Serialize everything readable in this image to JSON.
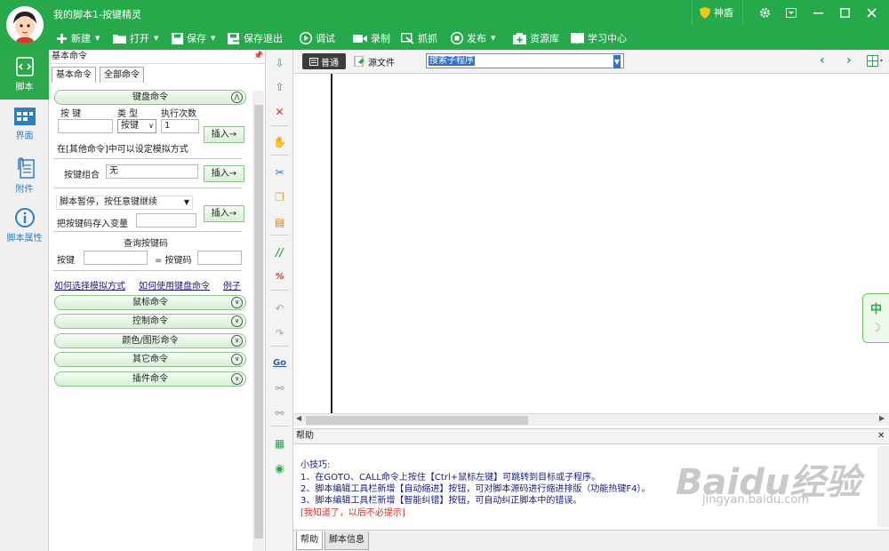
{
  "window": {
    "title": "我的脚本1-按键精灵",
    "shield_label": "神盾"
  },
  "toolbar": {
    "new": "新建",
    "open": "打开",
    "save": "保存",
    "save_exit": "保存退出",
    "debug": "调试",
    "record": "录制",
    "capture": "抓抓",
    "publish": "发布",
    "library": "资源库",
    "learn": "学习中心"
  },
  "nav": {
    "script": "脚本",
    "ui": "界面",
    "attach": "附件",
    "props": "脚本属性"
  },
  "panel": {
    "title": "基本命令",
    "tabs": [
      "基本命令",
      "全部命令"
    ],
    "keyboard": {
      "header": "键盘命令",
      "col_key": "按 键",
      "col_type": "类 型",
      "col_times": "执行次数",
      "type_value": "按键",
      "times_value": "1",
      "insert": "插入→",
      "note": "在[其他命令]中可以设定模拟方式",
      "combo_label": "按键组合",
      "combo_value": "无",
      "pause_select": "脚本暂停，按任意键继续",
      "save_var_label": "把按键码存入变量",
      "query_title": "查询按键码",
      "query_key_label": "按键",
      "query_code_label": "= 按键码"
    },
    "links": [
      "如何选择模拟方式",
      "如何使用键盘命令",
      "例子"
    ],
    "sections": [
      "鼠标命令",
      "控制命令",
      "颜色/图形命令",
      "其它命令",
      "插件命令"
    ]
  },
  "editor": {
    "tab_normal": "普通",
    "tab_source": "源文件",
    "sub_search": "搜索子程序"
  },
  "ime": {
    "lang": "中",
    "mode": "☽"
  },
  "help": {
    "header": "帮助",
    "tip_title": "小技巧:",
    "lines": [
      "1、在GOTO、CALL命令上按住【Ctrl+鼠标左键】可跳转到目标或子程序。",
      "2、脚本编辑工具栏新增【自动缩进】按钮，可对脚本源码进行缩进排版（功能热键F4）。",
      "3、脚本编辑工具栏新增【智能纠错】按钮，可自动纠正脚本中的错误。"
    ],
    "dismiss": "[我知道了，以后不必提示]",
    "tabs": [
      "帮助",
      "脚本信息"
    ]
  },
  "watermark": {
    "brand": "Baidu经验",
    "url": "jingyan.baidu.com"
  }
}
